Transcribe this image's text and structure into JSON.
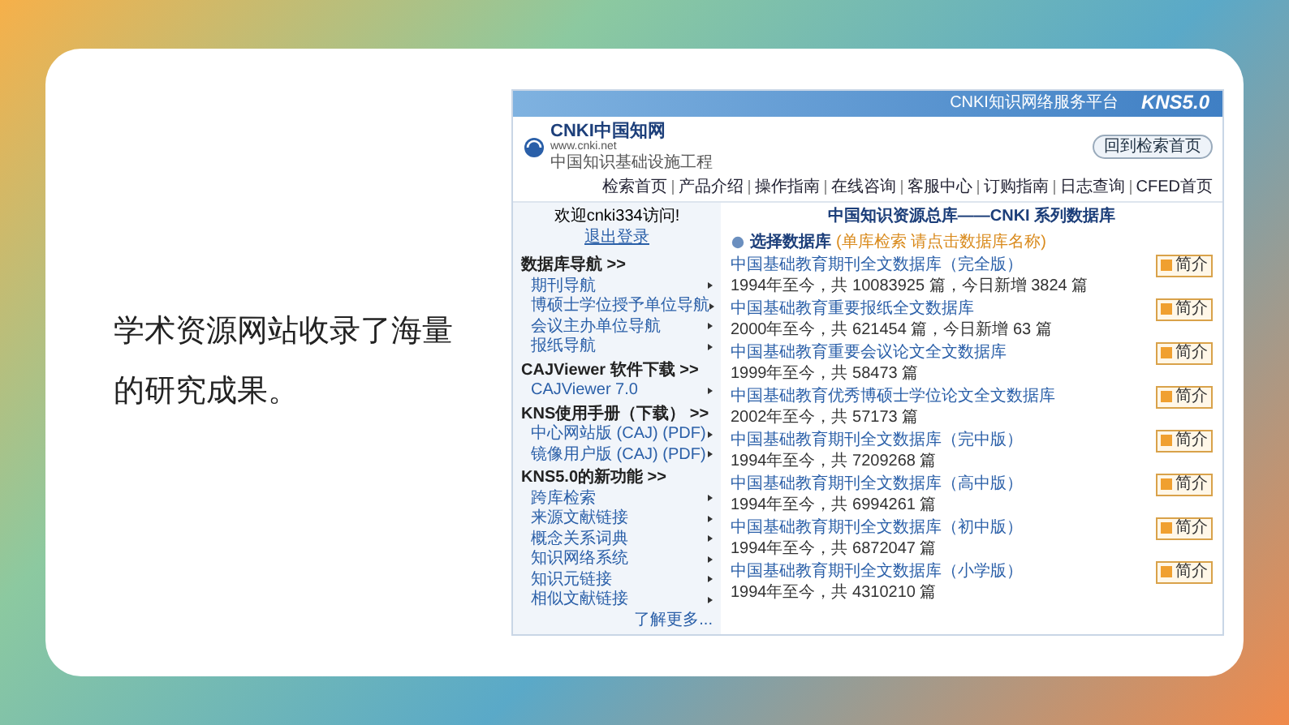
{
  "slide": {
    "text": "学术资源网站收录了海量的研究成果。"
  },
  "screenshot": {
    "banner_title": "CNKI知识网络服务平台",
    "version": "KNS5.0",
    "logo": {
      "brand": "CNKI中国知网",
      "url": "www.cnki.net",
      "subtitle": "中国知识基础设施工程"
    },
    "nav_links": [
      "检索首页",
      "产品介绍",
      "操作指南",
      "在线咨询",
      "客服中心",
      "订购指南",
      "日志查询",
      "CFED首页"
    ],
    "home_button": "回到检索首页",
    "welcome": "欢迎cnki334访问!",
    "logout": "退出登录",
    "sidebar_sections": [
      {
        "title": "数据库导航 >>",
        "items": [
          "期刊导航",
          "博硕士学位授予单位导航",
          "会议主办单位导航",
          "报纸导航"
        ]
      },
      {
        "title": "CAJViewer 软件下载 >>",
        "items": [
          "CAJViewer 7.0"
        ]
      },
      {
        "title": "KNS使用手册（下载） >>",
        "items": [
          "中心网站版 (CAJ) (PDF)",
          "镜像用户版 (CAJ) (PDF)"
        ]
      },
      {
        "title": "KNS5.0的新功能 >>",
        "items": [
          "跨库检索",
          "来源文献链接",
          "概念关系词典",
          "知识网络系统",
          "知识元链接",
          "相似文献链接"
        ]
      }
    ],
    "more_link": "了解更多...",
    "page_title": "中国知识资源总库——CNKI 系列数据库",
    "select_label": "选择数据库",
    "select_hint": "(单库检索 请点击数据库名称)",
    "databases": [
      {
        "name": "中国基础教育期刊全文数据库（完全版）",
        "stats": "1994年至今，共 10083925 篇，今日新增 3824 篇",
        "button": "简介"
      },
      {
        "name": "中国基础教育重要报纸全文数据库",
        "stats": "2000年至今，共 621454 篇，今日新增 63 篇",
        "button": "简介"
      },
      {
        "name": "中国基础教育重要会议论文全文数据库",
        "stats": "1999年至今，共 58473 篇",
        "button": "简介"
      },
      {
        "name": "中国基础教育优秀博硕士学位论文全文数据库",
        "stats": "2002年至今，共 57173 篇",
        "button": "简介"
      },
      {
        "name": "中国基础教育期刊全文数据库（完中版）",
        "stats": "1994年至今，共 7209268 篇",
        "button": "简介"
      },
      {
        "name": "中国基础教育期刊全文数据库（高中版）",
        "stats": "1994年至今，共 6994261 篇",
        "button": "简介"
      },
      {
        "name": "中国基础教育期刊全文数据库（初中版）",
        "stats": "1994年至今，共 6872047 篇",
        "button": "简介"
      },
      {
        "name": "中国基础教育期刊全文数据库（小学版）",
        "stats": "1994年至今，共 4310210 篇",
        "button": "简介"
      }
    ]
  }
}
